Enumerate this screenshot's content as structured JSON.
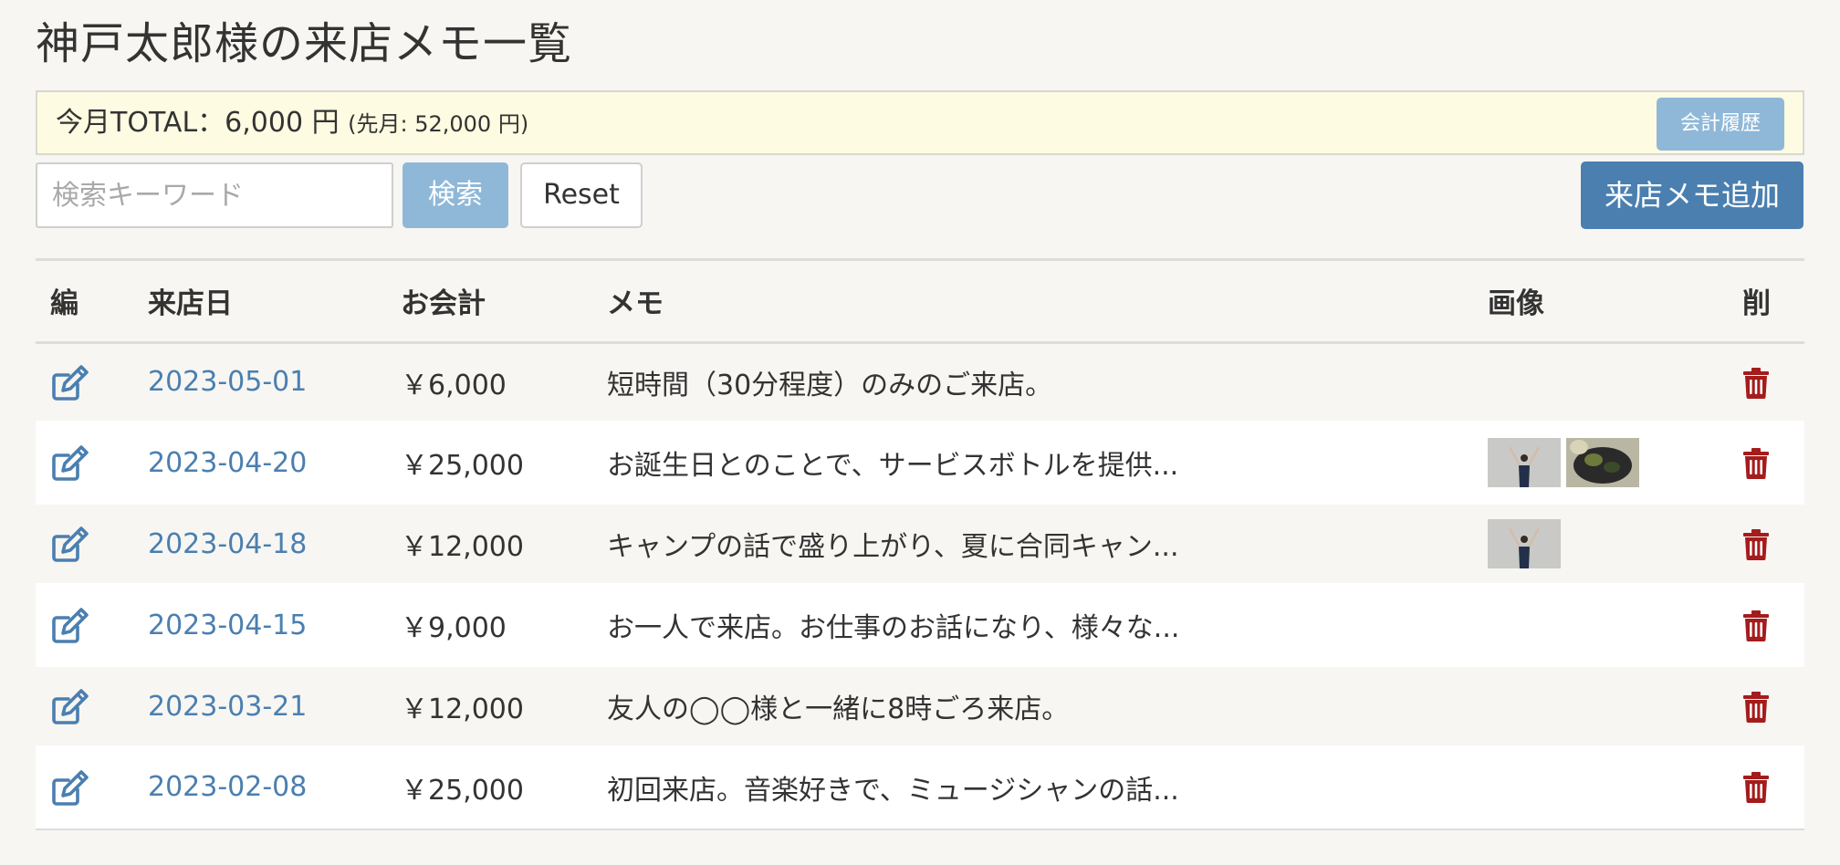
{
  "page_title": "神戸太郎様の来店メモ一覧",
  "total_bar": {
    "label": "今月TOTAL：6,000 円",
    "sub": "(先月: 52,000 円)",
    "history_button": "会計履歴"
  },
  "search": {
    "placeholder": "検索キーワード",
    "value": "",
    "search_button": "検索",
    "reset_button": "Reset"
  },
  "add_button": "来店メモ追加",
  "table": {
    "headers": [
      "編",
      "来店日",
      "お会計",
      "メモ",
      "画像",
      "削"
    ],
    "rows": [
      {
        "date": "2023-05-01",
        "amount": "￥6,000",
        "memo": "短時間（30分程度）のみのご来店。",
        "images": []
      },
      {
        "date": "2023-04-20",
        "amount": "￥25,000",
        "memo": "お誕生日とのことで、サービスボトルを提供...",
        "images": [
          "person-photo",
          "food-photo"
        ]
      },
      {
        "date": "2023-04-18",
        "amount": "￥12,000",
        "memo": "キャンプの話で盛り上がり、夏に合同キャン...",
        "images": [
          "person-photo"
        ]
      },
      {
        "date": "2023-04-15",
        "amount": "￥9,000",
        "memo": "お一人で来店。お仕事のお話になり、様々な...",
        "images": []
      },
      {
        "date": "2023-03-21",
        "amount": "￥12,000",
        "memo": "友人の◯◯様と一緒に8時ごろ来店。",
        "images": []
      },
      {
        "date": "2023-02-08",
        "amount": "￥25,000",
        "memo": "初回来店。音楽好きで、ミュージシャンの話...",
        "images": []
      }
    ]
  },
  "icons": {
    "edit": "edit-icon",
    "delete": "trash-icon"
  },
  "colors": {
    "link": "#4a7fb0",
    "primary_button": "#4a7fb0",
    "light_button": "#8fb8d8",
    "delete": "#a51c1c",
    "total_bar_bg": "#fdfbe1"
  }
}
